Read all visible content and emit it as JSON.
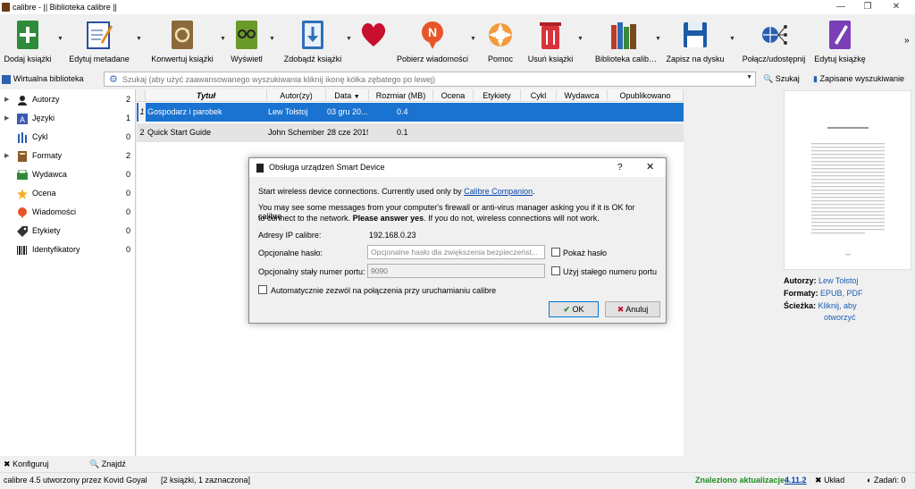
{
  "window": {
    "title": "calibre - || Biblioteka calibre ||"
  },
  "toolbar": {
    "items": [
      {
        "label": "Dodaj książki",
        "icon": "add-book-icon"
      },
      {
        "label": "Edytuj metadane",
        "icon": "edit-metadata-icon"
      },
      {
        "label": "Konwertuj książki",
        "icon": "convert-icon"
      },
      {
        "label": "Wyświetl",
        "icon": "view-icon"
      },
      {
        "label": "Zdobądź książki",
        "icon": "get-books-icon"
      },
      {
        "label": "Pobierz wiadomości",
        "icon": "news-icon"
      },
      {
        "label": "Pomoc",
        "icon": "help-icon"
      },
      {
        "label": "Usuń książki",
        "icon": "remove-icon"
      },
      {
        "label": "Biblioteka calib…",
        "icon": "library-icon"
      },
      {
        "label": "Zapisz na dysku",
        "icon": "save-icon"
      },
      {
        "label": "Połącz/udostępnij",
        "icon": "connect-icon"
      },
      {
        "label": "Edytuj książkę",
        "icon": "edit-book-icon"
      }
    ],
    "more": "»"
  },
  "search": {
    "virtual_library": "Wirtualna biblioteka",
    "placeholder": "Szukaj (aby użyć zaawansowanego wyszukiwania kliknij ikonę kółka zębatego po lewej)",
    "search_label": "Szukaj",
    "saved_label": "Zapisane wyszukiwanie"
  },
  "tag_browser": {
    "items": [
      {
        "label": "Autorzy",
        "count": "2"
      },
      {
        "label": "Języki",
        "count": "1"
      },
      {
        "label": "Cykl",
        "count": "0"
      },
      {
        "label": "Formaty",
        "count": "2"
      },
      {
        "label": "Wydawca",
        "count": "0"
      },
      {
        "label": "Ocena",
        "count": "0"
      },
      {
        "label": "Wiadomości",
        "count": "0"
      },
      {
        "label": "Etykiety",
        "count": "0"
      },
      {
        "label": "Identyfikatory",
        "count": "0"
      }
    ],
    "configure": "Konfiguruj",
    "find": "Znajdź"
  },
  "table": {
    "headers": [
      "Tytuł",
      "Autor(zy)",
      "Data",
      "Rozmiar (MB)",
      "Ocena",
      "Etykiety",
      "Cykl",
      "Wydawca",
      "Opublikowano"
    ],
    "rows": [
      {
        "num": "1",
        "title": "Gospodarz i parobek",
        "author": "Lew Tołstoj",
        "date": "03 gru 20...",
        "size": "0.4"
      },
      {
        "num": "2",
        "title": "Quick Start Guide",
        "author": "John Schember",
        "date": "28 cze 2019",
        "size": "0.1"
      }
    ]
  },
  "book_details": {
    "authors_label": "Autorzy:",
    "authors_value": "Lew Tołstoj",
    "formats_label": "Formaty:",
    "formats_value": "EPUB, PDF",
    "path_label": "Ścieżka:",
    "path_value_1": "Kliknij, aby",
    "path_value_2": "otworzyć"
  },
  "dialog": {
    "title": "Obsługa urządzeń Smart Device",
    "help": "?",
    "intro_pre": "Start wireless device connections. Currently used only by ",
    "intro_link": "Calibre Companion",
    "intro_post": ".",
    "warning_1": "You may see some messages from your computer's firewall or anti-virus manager asking you if it is OK for calibre",
    "warning_2_pre": "to connect to the network. ",
    "warning_2_bold": "Please answer yes",
    "warning_2_post": ". If you do not, wireless connections will not work.",
    "ip_label": "Adresy IP calibre:",
    "ip_value": "192.168.0.23",
    "password_label": "Opcjonalne hasło:",
    "password_placeholder": "Opcjonalne hasło dla zwiększenia bezpieczeńst...",
    "show_password": "Pokaż hasło",
    "port_label": "Opcjonalny stały numer portu:",
    "port_value": "9090",
    "fixed_port": "Użyj stałego numeru portu",
    "autostart": "Automatycznie zezwól na połączenia przy uruchamianiu calibre",
    "ok": "OK",
    "cancel": "Anuluj"
  },
  "status": {
    "left": "calibre 4.5 utworzony przez Kovid Goyal",
    "books": "[2 książki, 1 zaznaczona]",
    "update_label": "Znaleziono aktualizacje:",
    "update_version": "4.11.2",
    "layout": "Układ",
    "jobs": "Zadań: 0"
  },
  "colors": {
    "selection": "#1a73d1",
    "link": "#0645ad",
    "update": "#1e8a1e"
  }
}
